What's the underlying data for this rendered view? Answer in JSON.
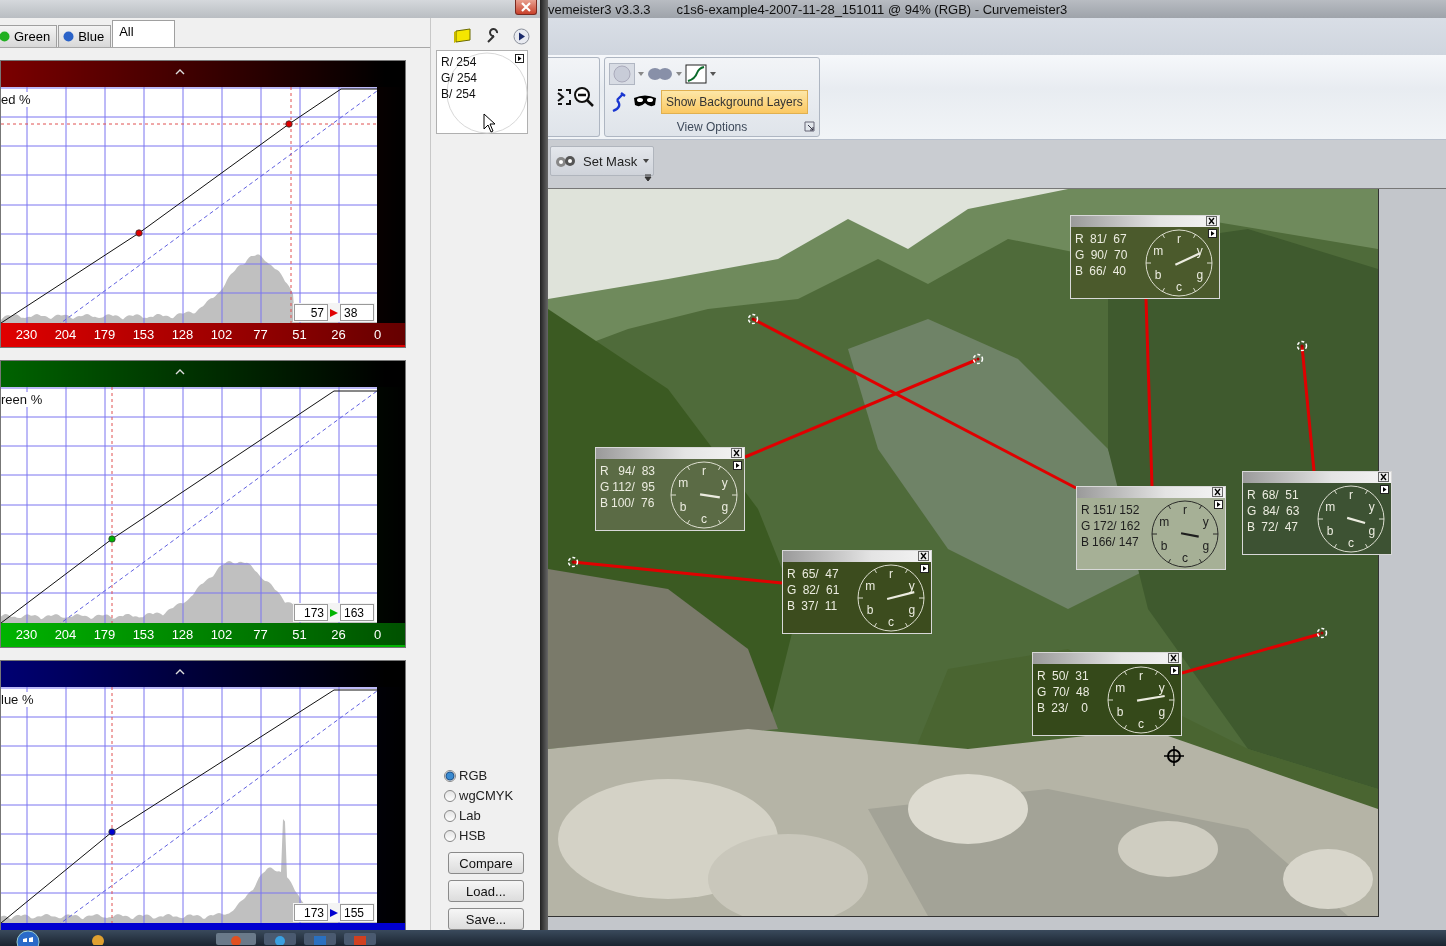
{
  "curves_window": {
    "tabs": [
      {
        "label": "Green",
        "selected": false,
        "color": "#22b022"
      },
      {
        "label": "Blue",
        "selected": false,
        "color": "#2a62c8"
      },
      {
        "label": "All",
        "selected": true
      }
    ],
    "curves": [
      {
        "channel_label": "ed %",
        "color": "#e00000",
        "input": "57",
        "output": "38",
        "axis_labels": [
          "230",
          "204",
          "179",
          "153",
          "128",
          "102",
          "77",
          "51",
          "26",
          "0"
        ]
      },
      {
        "channel_label": "reen %",
        "color": "#00b400",
        "input": "173",
        "output": "163",
        "axis_labels": [
          "230",
          "204",
          "179",
          "153",
          "128",
          "102",
          "77",
          "51",
          "26",
          "0"
        ]
      },
      {
        "channel_label": "lue %",
        "color": "#0000d0",
        "input": "173",
        "output": "155"
      }
    ],
    "readout": [
      "R/ 254",
      "G/ 254",
      "B/ 254"
    ],
    "color_modes": [
      {
        "label": "RGB",
        "selected": true
      },
      {
        "label": "wgCMYK",
        "selected": false
      },
      {
        "label": "Lab",
        "selected": false
      },
      {
        "label": "HSB",
        "selected": false
      }
    ],
    "buttons": [
      "Compare",
      "Load...",
      "Save..."
    ]
  },
  "main_window": {
    "title_parts": [
      "vemeister3 v3.3.3",
      "c1s6-example4-2007-11-28_151011 @ 94% (RGB) - Curvemeister3"
    ],
    "ribbon": {
      "show_background_layers": {
        "label": "Show Background Layers",
        "on": true
      },
      "group_label": "View Options"
    },
    "set_mask": "Set Mask",
    "probes": [
      {
        "color": "#4b5a2c",
        "rows": [
          {
            "channel": "R",
            "reading": " 81/  67"
          },
          {
            "channel": "G",
            "reading": " 90/  70"
          },
          {
            "channel": "B",
            "reading": " 66/  40"
          }
        ],
        "dial_labels": [
          "r",
          "y",
          "g",
          "c",
          "b",
          "m"
        ]
      },
      {
        "color": "#5b6b45",
        "rows": [
          {
            "channel": "R",
            "reading": "  94/  83"
          },
          {
            "channel": "G",
            "reading": "112/  95"
          },
          {
            "channel": "B",
            "reading": "100/  76"
          }
        ],
        "dial_labels": [
          "r",
          "y",
          "g",
          "c",
          "b",
          "m"
        ]
      },
      {
        "color": "#3d5233",
        "rows": [
          {
            "channel": "R",
            "reading": " 68/  51"
          },
          {
            "channel": "G",
            "reading": " 84/  63"
          },
          {
            "channel": "B",
            "reading": " 72/  47"
          }
        ],
        "dial_labels": [
          "r",
          "y",
          "g",
          "c",
          "b",
          "m"
        ]
      },
      {
        "color": "#a6b096",
        "rows": [
          {
            "channel": "R",
            "reading": "151/ 152"
          },
          {
            "channel": "G",
            "reading": "172/ 162"
          },
          {
            "channel": "B",
            "reading": "166/ 147"
          }
        ],
        "dial_labels": [
          "r",
          "y",
          "g",
          "c",
          "b",
          "m"
        ]
      },
      {
        "color": "#3c4c1e",
        "rows": [
          {
            "channel": "R",
            "reading": " 65/  47"
          },
          {
            "channel": "G",
            "reading": " 82/  61"
          },
          {
            "channel": "B",
            "reading": " 37/  11"
          }
        ],
        "dial_labels": [
          "r",
          "y",
          "g",
          "c",
          "b",
          "m"
        ]
      },
      {
        "color": "#35491a",
        "rows": [
          {
            "channel": "R",
            "reading": " 50/  31"
          },
          {
            "channel": "G",
            "reading": " 70/  48"
          },
          {
            "channel": "B",
            "reading": " 23/    0"
          }
        ],
        "dial_labels": [
          "r",
          "y",
          "g",
          "c",
          "b",
          "m"
        ]
      }
    ]
  }
}
